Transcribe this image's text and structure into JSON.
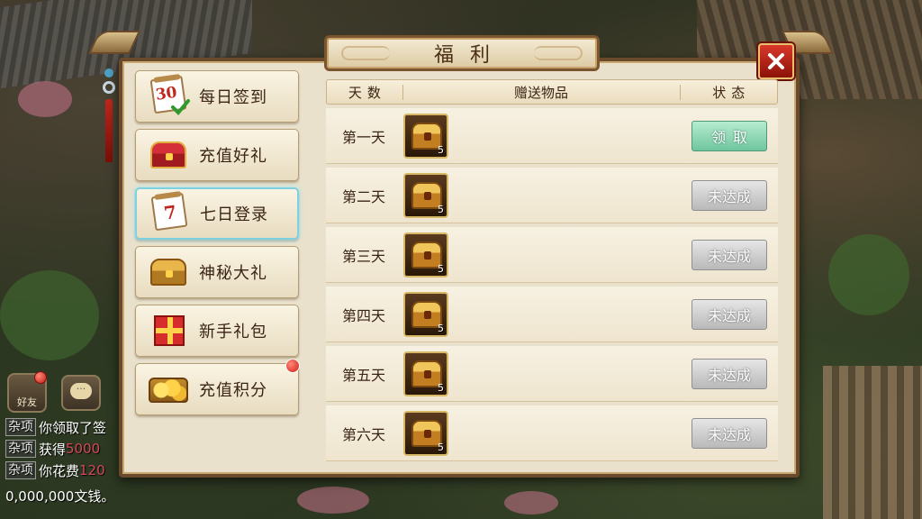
{
  "window": {
    "title": "福利",
    "close_label": "✕"
  },
  "sidebar": {
    "items": [
      {
        "label": "每日签到",
        "icon": "calendar-30-icon",
        "active": false,
        "badge": false
      },
      {
        "label": "充值好礼",
        "icon": "treasure-chest-icon",
        "active": false,
        "badge": false
      },
      {
        "label": "七日登录",
        "icon": "calendar-7-icon",
        "active": true,
        "badge": false
      },
      {
        "label": "神秘大礼",
        "icon": "gold-chest-icon",
        "active": false,
        "badge": false
      },
      {
        "label": "新手礼包",
        "icon": "gift-box-icon",
        "active": false,
        "badge": false
      },
      {
        "label": "充值积分",
        "icon": "coin-chest-icon",
        "active": false,
        "badge": true
      }
    ],
    "calendar_30_num": "30",
    "calendar_7_num": "7"
  },
  "table": {
    "headers": {
      "day": "天数",
      "item": "赠送物品",
      "status": "状态"
    },
    "rows": [
      {
        "day": "第一天",
        "qty": "5",
        "status": "领取",
        "state": "claim"
      },
      {
        "day": "第二天",
        "qty": "5",
        "status": "未达成",
        "state": "locked"
      },
      {
        "day": "第三天",
        "qty": "5",
        "status": "未达成",
        "state": "locked"
      },
      {
        "day": "第四天",
        "qty": "5",
        "status": "未达成",
        "state": "locked"
      },
      {
        "day": "第五天",
        "qty": "5",
        "status": "未达成",
        "state": "locked"
      },
      {
        "day": "第六天",
        "qty": "5",
        "status": "未达成",
        "state": "locked"
      }
    ]
  },
  "hud": {
    "friend_label": "好友",
    "chat_bubble": "···",
    "chat": [
      {
        "tag": "杂项",
        "text": "你领取了签"
      },
      {
        "tag": "杂项",
        "text": "获得",
        "highlight": "5000"
      },
      {
        "tag": "杂项",
        "text": "你花费",
        "highlight": "120"
      }
    ],
    "chat_tail": "0,000,000文钱。"
  },
  "colors": {
    "claim_button": "#6fc59e",
    "locked_button": "#b9b9b9",
    "close_button": "#c0261c",
    "frame": "#6b4a2c"
  }
}
